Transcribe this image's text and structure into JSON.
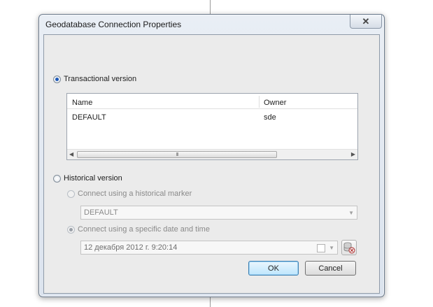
{
  "dialog": {
    "title": "Geodatabase Connection Properties",
    "close_glyph": "✕"
  },
  "transactional": {
    "label": "Transactional version",
    "selected": true,
    "table": {
      "columns": [
        "Name",
        "Owner"
      ],
      "rows": [
        {
          "name": "DEFAULT",
          "owner": "sde"
        }
      ],
      "scroll_thumb_glyph": "III",
      "scroll_left_glyph": "◀",
      "scroll_right_glyph": "▶"
    }
  },
  "historical": {
    "label": "Historical version",
    "selected": false,
    "marker_option": {
      "label": "Connect using a historical marker",
      "selected": false
    },
    "marker_value": "DEFAULT",
    "date_option": {
      "label": "Connect using a specific date and time",
      "selected": true
    },
    "date_value": "12 декабря  2012 г.   9:20:14",
    "dropdown_glyph": "▼"
  },
  "buttons": {
    "ok": "OK",
    "cancel": "Cancel"
  },
  "colors": {
    "accent": "#1c58b8",
    "ok_border": "#3c7fb1"
  }
}
